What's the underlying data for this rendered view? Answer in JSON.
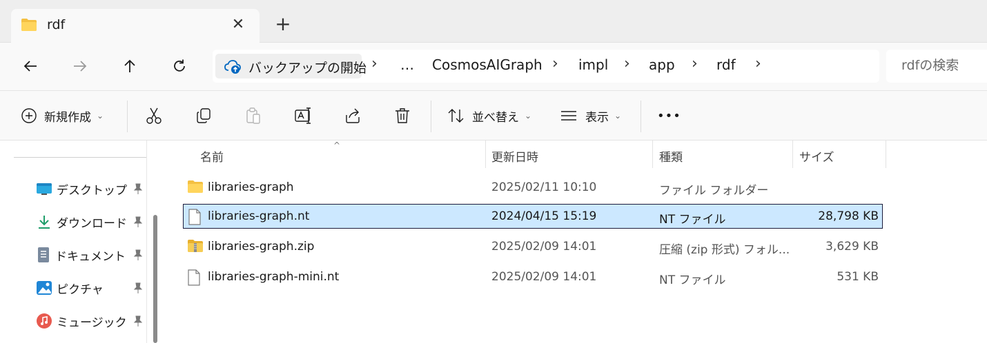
{
  "window": {
    "tab_title": "rdf",
    "close_glyph": "✕",
    "newtab_glyph": "+"
  },
  "nav": {
    "backup_label": "バックアップの開始",
    "breadcrumbs": [
      "…",
      "CosmosAIGraph",
      "impl",
      "app",
      "rdf"
    ],
    "separator": "›",
    "search_placeholder": "rdfの検索"
  },
  "commands": {
    "new_label": "新規作成",
    "sort_label": "並べ替え",
    "view_label": "表示",
    "more_label": "•••",
    "caret": "⌄"
  },
  "sidebar": {
    "items": [
      {
        "label": "デスクトップ",
        "icon": "desktop-icon"
      },
      {
        "label": "ダウンロード",
        "icon": "download-icon"
      },
      {
        "label": "ドキュメント",
        "icon": "documents-icon"
      },
      {
        "label": "ピクチャ",
        "icon": "pictures-icon"
      },
      {
        "label": "ミュージック",
        "icon": "music-icon"
      }
    ]
  },
  "list": {
    "columns": {
      "name": "名前",
      "modified": "更新日時",
      "type": "種類",
      "size": "サイズ"
    },
    "sort_indicator": "^",
    "rows": [
      {
        "name": "libraries-graph",
        "modified": "2025/02/11 10:10",
        "type": "ファイル フォルダー",
        "size": "",
        "icon": "folder-icon",
        "selected": false
      },
      {
        "name": "libraries-graph.nt",
        "modified": "2024/04/15 15:19",
        "type": "NT ファイル",
        "size": "28,798 KB",
        "icon": "file-icon",
        "selected": true
      },
      {
        "name": "libraries-graph.zip",
        "modified": "2025/02/09 14:01",
        "type": "圧縮 (zip 形式) フォル...",
        "size": "3,629 KB",
        "icon": "zip-folder-icon",
        "selected": false
      },
      {
        "name": "libraries-graph-mini.nt",
        "modified": "2025/02/09 14:01",
        "type": "NT ファイル",
        "size": "531 KB",
        "icon": "file-icon",
        "selected": false
      }
    ]
  },
  "colors": {
    "accent": "#0067c0",
    "selection": "#cce8ff",
    "folder": "#f4c042"
  }
}
